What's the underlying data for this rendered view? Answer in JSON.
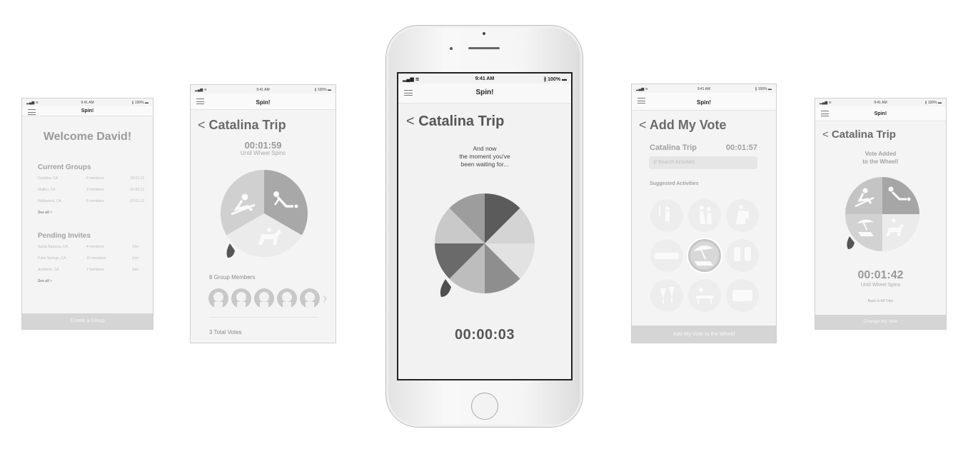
{
  "status": {
    "time": "9:41 AM",
    "battery": "100%"
  },
  "app": {
    "name": "Spin!"
  },
  "screen_home": {
    "welcome": "Welcome David!",
    "current_title": "Current Groups",
    "current_groups": [
      {
        "place": "Catalina, CA",
        "members": "6 members",
        "time": "00:01:12"
      },
      {
        "place": "Malibu, CA",
        "members": "3 members",
        "time": "01:02:12"
      },
      {
        "place": "Hollywood, CA",
        "members": "6 members",
        "time": "02:01:12"
      }
    ],
    "see_all": "See all",
    "pending_title": "Pending Invites",
    "pending_invites": [
      {
        "place": "Santa Barbara, CA",
        "members": "4 members",
        "action": "Join"
      },
      {
        "place": "Palm Springs, CA",
        "members": "10 members",
        "action": "Join"
      },
      {
        "place": "Anaheim, CA",
        "members": "7 members",
        "action": "Join"
      }
    ],
    "create_button": "Create a Group"
  },
  "screen_trip": {
    "title": "Catalina Trip",
    "timer": "00:01:59",
    "timer_sub": "Until Wheel Spins",
    "members_label": "8 Group Members",
    "votes_label": "3 Total Votes"
  },
  "screen_spin": {
    "title": "Catalina Trip",
    "message": [
      "And now",
      "the moment you've",
      "been waiting for..."
    ],
    "timer": "00:00:03"
  },
  "screen_vote": {
    "title": "Add My Vote",
    "trip": "Catalina Trip",
    "timer": "00:01:57",
    "search_placeholder": "Search Activities",
    "suggested": "Suggested Activities",
    "add_button": "Add My Vote to the Wheel"
  },
  "screen_added": {
    "title": "Catalina Trip",
    "message": [
      "Vote Added",
      "to the Wheel!"
    ],
    "timer": "00:01:42",
    "timer_sub": "Until Wheel Spins",
    "back": "Back to All Trips",
    "change_button": "Change My Vote"
  },
  "colors": {
    "wheel_dark": "#5e5e5e",
    "wheel_mid": "#9a9a9a",
    "wheel_light": "#e6e6e6",
    "muted": "#a8a8a8",
    "bar": "#d5d5d5"
  },
  "icons": [
    "hamburger-icon",
    "back-chevron-icon",
    "signal-icon",
    "wifi-icon",
    "bluetooth-icon",
    "battery-icon",
    "search-icon",
    "avatar-icon",
    "chevron-right-icon",
    "snowboard-icon",
    "scuba-icon",
    "horse-riding-icon",
    "beach-umbrella-icon",
    "tennis-icon",
    "dance-icon",
    "hiking-icon",
    "wine-icon",
    "picnic-icon",
    "money-icon",
    "binoculars-icon",
    "ticket-icon",
    "wheel-pointer-icon"
  ]
}
